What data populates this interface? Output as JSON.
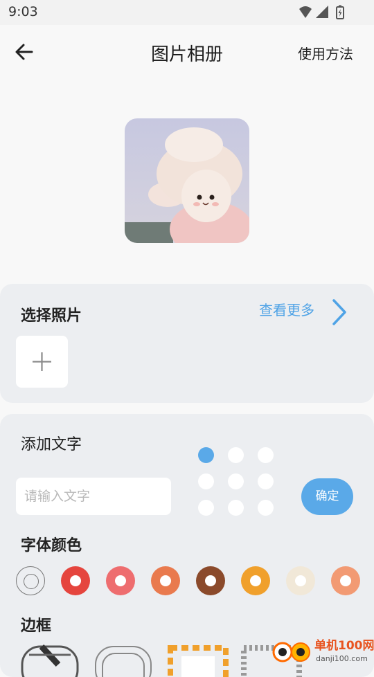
{
  "status": {
    "time": "9:03",
    "icons": [
      "wifi-icon",
      "signal-icon",
      "battery-icon"
    ]
  },
  "header": {
    "back_icon": "arrow-left-icon",
    "title": "图片相册",
    "help": "使用方法"
  },
  "select_photo": {
    "title": "选择照片",
    "more": "查看更多",
    "add_icon": "plus-icon"
  },
  "add_text": {
    "title": "添加文字",
    "placeholder": "请输入文字",
    "value": "",
    "position_grid": {
      "rows": 3,
      "cols": 3,
      "selected": 0
    },
    "confirm": "确定"
  },
  "font_color": {
    "title": "字体颜色",
    "swatches": [
      "none",
      "#e5453e",
      "#ee6d6f",
      "#e97a4e",
      "#8b4a2b",
      "#f0a02c",
      "#f1e8d8",
      "#f29a73"
    ]
  },
  "border": {
    "title": "边框"
  },
  "watermark": {
    "text": "单机100网",
    "sub": "danji100.com"
  },
  "colors": {
    "accent": "#5aa9e8",
    "card": "#eceef1",
    "background": "#f8f8f8"
  }
}
